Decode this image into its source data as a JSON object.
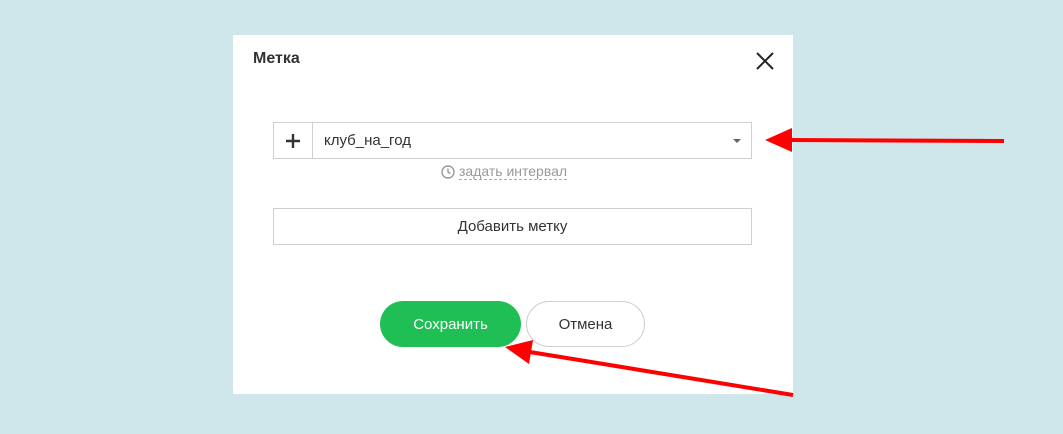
{
  "dialog": {
    "title": "Метка",
    "close_icon": "close-icon"
  },
  "tag": {
    "add_icon": "plus-icon",
    "selected_value": "клуб_на_год",
    "dropdown_icon": "chevron-down-icon"
  },
  "interval": {
    "icon": "clock-icon",
    "label": "задать интервал"
  },
  "buttons": {
    "add_tag": "Добавить метку",
    "save": "Сохранить",
    "cancel": "Отмена"
  },
  "colors": {
    "background": "#cfe6eb",
    "save_button": "#1fbf55",
    "annotation_arrow": "#ff0000"
  }
}
